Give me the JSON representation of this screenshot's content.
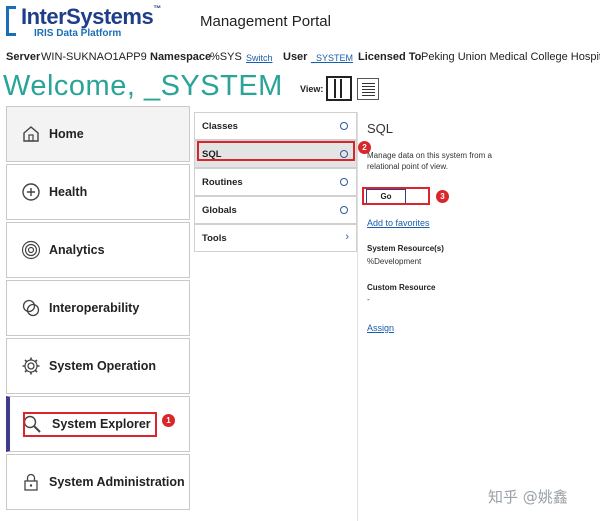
{
  "header": {
    "logo_name": "InterSystems",
    "logo_trademark": "™",
    "logo_product": "IRIS Data Platform",
    "portal_title": "Management Portal"
  },
  "infobar": {
    "server_label": "Server",
    "server_value": "WIN-SUKNAO1APP9",
    "namespace_label": "Namespace",
    "namespace_value": "%SYS",
    "switch_link": "Switch",
    "user_label": "User",
    "user_value": "_SYSTEM",
    "licensed_label": "Licensed To",
    "licensed_value": "Peking Union Medical College Hospital"
  },
  "welcome": "Welcome, _SYSTEM",
  "view": {
    "label": "View:",
    "columns_icon": "columns-view-icon",
    "list_icon": "list-view-icon"
  },
  "nav": {
    "items": [
      {
        "label": "Home",
        "icon": "home-icon"
      },
      {
        "label": "Health",
        "icon": "health-icon"
      },
      {
        "label": "Analytics",
        "icon": "analytics-icon"
      },
      {
        "label": "Interoperability",
        "icon": "interoperability-icon"
      },
      {
        "label": "System Operation",
        "icon": "gear-icon"
      },
      {
        "label": "System Explorer",
        "icon": "magnifier-icon"
      },
      {
        "label": "System Administration",
        "icon": "lock-icon"
      }
    ],
    "active": "System Explorer"
  },
  "submenu": {
    "items": [
      {
        "label": "Classes",
        "indicator": "circle"
      },
      {
        "label": "SQL",
        "indicator": "circle"
      },
      {
        "label": "Routines",
        "indicator": "circle"
      },
      {
        "label": "Globals",
        "indicator": "circle"
      },
      {
        "label": "Tools",
        "indicator": "›"
      }
    ],
    "selected": "SQL"
  },
  "detail": {
    "title": "SQL",
    "description": "Manage data on this system from a relational point of view.",
    "go_button": "Go",
    "add_favorites": "Add to favorites",
    "resource_heading": "System Resource(s)",
    "resource_value": "%Development",
    "custom_heading": "Custom Resource",
    "custom_value": "-",
    "assign_link": "Assign"
  },
  "annotations": {
    "badge1": "1",
    "badge2": "2",
    "badge3": "3",
    "color": "#d9262b"
  },
  "watermark": "知乎 @姚鑫",
  "colors": {
    "brand_blue": "#1f3e8a",
    "welcome_teal": "#2aa399",
    "link_blue": "#1b5ea8",
    "active_bar": "#3d3d8c"
  }
}
